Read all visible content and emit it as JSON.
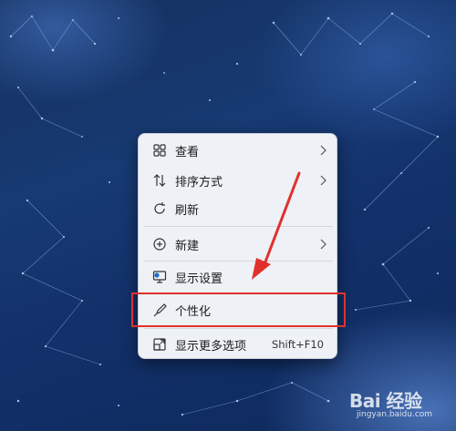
{
  "context_menu": {
    "items": [
      {
        "label": "查看",
        "icon": "grid-icon",
        "has_submenu": true
      },
      {
        "label": "排序方式",
        "icon": "sort-icon",
        "has_submenu": true
      },
      {
        "label": "刷新",
        "icon": "refresh-icon",
        "has_submenu": false
      },
      {
        "label": "新建",
        "icon": "plus-circle-icon",
        "has_submenu": true
      },
      {
        "label": "显示设置",
        "icon": "monitor-settings-icon",
        "has_submenu": false
      },
      {
        "label": "个性化",
        "icon": "brush-icon",
        "has_submenu": false
      },
      {
        "label": "显示更多选项",
        "icon": "expand-icon",
        "has_submenu": false,
        "shortcut": "Shift+F10"
      }
    ]
  },
  "annotation": {
    "highlighted_item": "个性化",
    "color": "#e0312c"
  },
  "watermark": {
    "text": "Bai 经验",
    "sub": "jingyan.baidu.com"
  }
}
